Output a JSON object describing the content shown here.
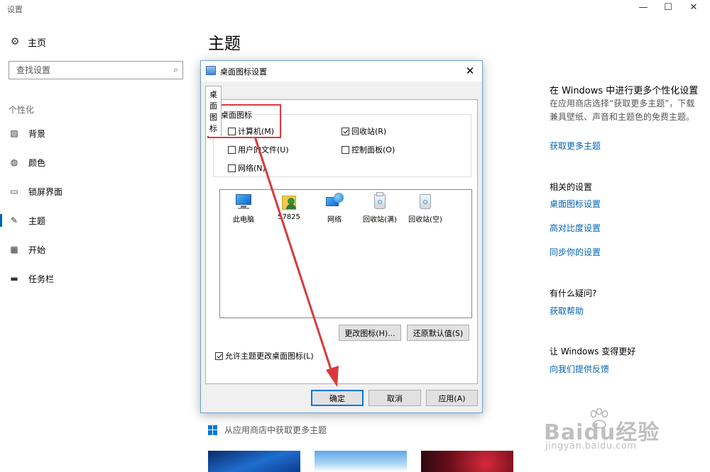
{
  "app_title": "设置",
  "window_controls": {
    "minimize": "—",
    "maximize": "☐",
    "close": "✕"
  },
  "sidebar": {
    "home_label": "主页",
    "search_placeholder": "查找设置",
    "section_label": "个性化",
    "items": [
      {
        "label": "背景",
        "icon": "image-icon"
      },
      {
        "label": "颜色",
        "icon": "palette-icon"
      },
      {
        "label": "锁屏界面",
        "icon": "lock-screen-icon"
      },
      {
        "label": "主题",
        "icon": "theme-brush-icon",
        "active": true
      },
      {
        "label": "开始",
        "icon": "start-grid-icon"
      },
      {
        "label": "任务栏",
        "icon": "taskbar-icon"
      }
    ]
  },
  "main": {
    "title": "主题",
    "store_link": "从应用商店中获取更多主题"
  },
  "right_column": {
    "more_heading": "在 Windows 中进行更多个性化设置",
    "more_text": "在应用商店选择“获取更多主题”，下载兼具壁纸、声音和主题色的免费主题。",
    "more_link": "获取更多主题",
    "related_heading": "相关的设置",
    "related_links": [
      "桌面图标设置",
      "高对比度设置",
      "同步你的设置"
    ],
    "question_heading": "有什么疑问?",
    "help_link": "获取帮助",
    "improve_heading": "让 Windows 变得更好",
    "feedback_link": "向我们提供反馈"
  },
  "dialog": {
    "title": "桌面图标设置",
    "tab": "桌面图标",
    "group_label": "桌面图标",
    "checkboxes": [
      {
        "label": "计算机(M)",
        "checked": false
      },
      {
        "label": "回收站(R)",
        "checked": true
      },
      {
        "label": "用户的文件(U)",
        "checked": false
      },
      {
        "label": "控制面板(O)",
        "checked": false
      },
      {
        "label": "网络(N)",
        "checked": false
      }
    ],
    "icons": [
      "此电脑",
      "57825",
      "网络",
      "回收站(满)",
      "回收站(空)"
    ],
    "change_icon_button": "更改图标(H)...",
    "restore_default_button": "还原默认值(S)",
    "allow_themes_checkbox": {
      "label": "允许主题更改桌面图标(L)",
      "checked": true
    },
    "ok_button": "确定",
    "cancel_button": "取消",
    "apply_button": "应用(A)"
  },
  "watermark": {
    "logo": "Baidu经验",
    "url": "jingyan.baidu.com"
  },
  "colors": {
    "accent": "#0063b1",
    "annotation": "#d9393d",
    "dialog_border": "#6f9fd8"
  }
}
